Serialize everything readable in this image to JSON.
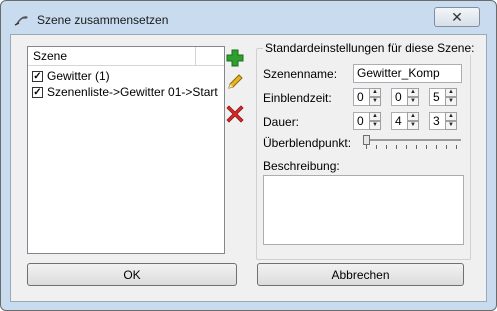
{
  "window": {
    "title": "Szene zusammensetzen",
    "close_glyph": "✕"
  },
  "scene_list": {
    "column_header": "Szene",
    "items": [
      {
        "label": "Gewitter (1)",
        "checked": true
      },
      {
        "label": "Szenenliste->Gewitter 01->Start",
        "checked": true
      }
    ]
  },
  "side_buttons": {
    "add": "plus-icon",
    "edit": "pencil-icon",
    "delete": "red-x-icon"
  },
  "settings": {
    "group_title": "Standardeinstellungen für diese Szene:",
    "scene_name_label": "Szenenname:",
    "scene_name_value": "Gewitter_Komp",
    "fade_in_label": "Einblendzeit:",
    "fade_in_values": [
      "0",
      "0",
      "5"
    ],
    "duration_label": "Dauer:",
    "duration_values": [
      "0",
      "4",
      "3"
    ],
    "crossfade_label": "Überblendpunkt:",
    "crossfade_position": 0,
    "description_label": "Beschreibung:",
    "description_value": ""
  },
  "buttons": {
    "ok": "OK",
    "cancel": "Abbrechen"
  },
  "colors": {
    "frame": "#c9dcef",
    "add_green": "#2e9e2e",
    "delete_red": "#d42a2a",
    "edit_yellow": "#e8b422"
  }
}
